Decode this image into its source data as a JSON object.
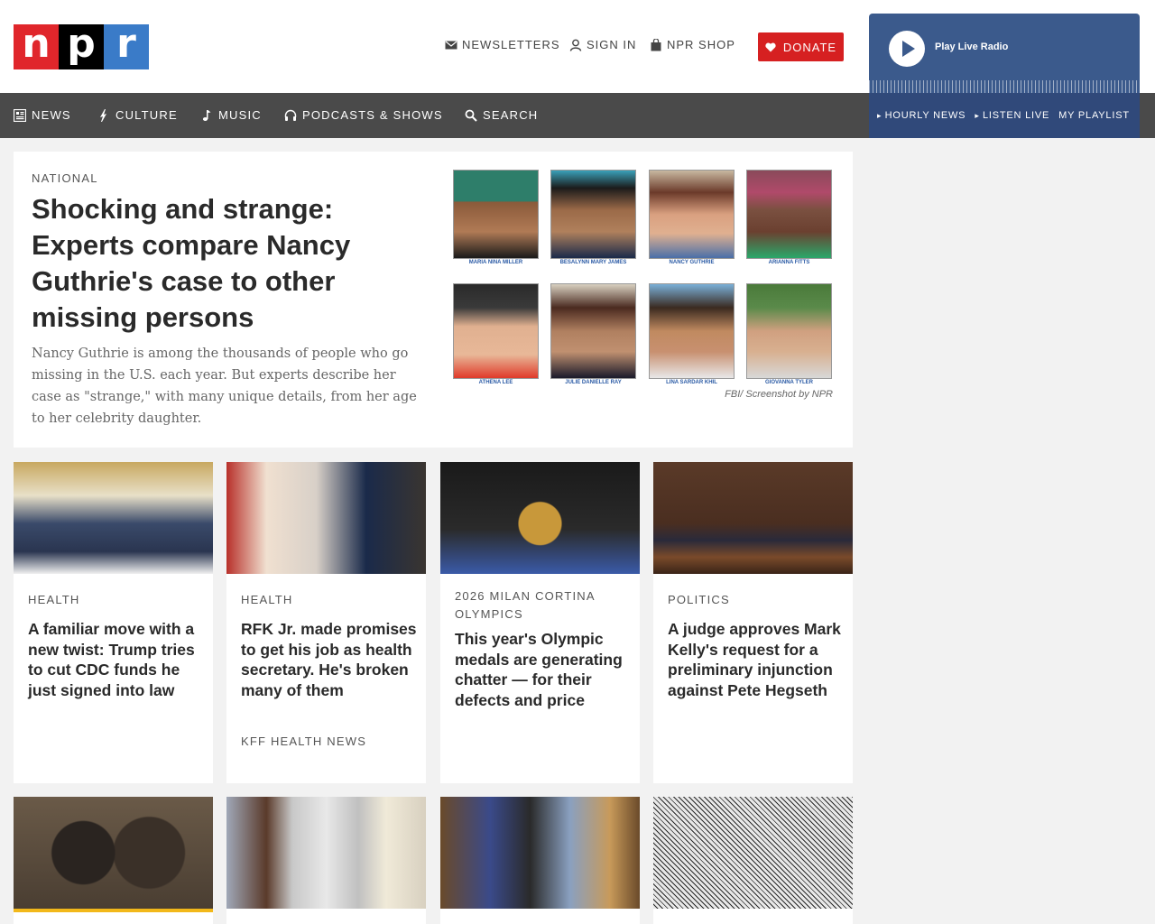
{
  "header": {
    "logo_letters": [
      "n",
      "p",
      "r"
    ],
    "utility": {
      "newsletters": "NEWSLETTERS",
      "sign_in": "SIGN IN",
      "shop": "NPR SHOP",
      "donate": "DONATE"
    }
  },
  "nav": {
    "items": [
      {
        "label": "NEWS",
        "icon": "news-icon"
      },
      {
        "label": "CULTURE",
        "icon": "culture-icon"
      },
      {
        "label": "MUSIC",
        "icon": "music-note-icon"
      },
      {
        "label": "PODCASTS & SHOWS",
        "icon": "headphones-icon"
      },
      {
        "label": "SEARCH",
        "icon": "search-icon"
      }
    ]
  },
  "player": {
    "title": "Play Live Radio",
    "links": [
      "HOURLY NEWS",
      "LISTEN LIVE",
      "MY PLAYLIST"
    ]
  },
  "feature": {
    "slug": "NATIONAL",
    "headline": "Shocking and strange: Experts compare Nancy Guthrie's case to other missing persons",
    "teaser": "Nancy Guthrie is among the thousands of people who go missing in the U.S. each year. But experts describe her case as \"strange,\" with many unique details, from her age to her celebrity daughter.",
    "photo_captions": [
      "MARIA NINA MILLER",
      "BESALYNN MARY JAMES",
      "NANCY GUTHRIE",
      "ARIANNA FITTS",
      "ATHENA LEE",
      "JULIE DANIELLE RAY",
      "LINA SARDAR KHIL",
      "GIOVANNA TYLER"
    ],
    "credit": "FBI/ Screenshot by NPR"
  },
  "cards": [
    {
      "slug": "HEALTH",
      "headline": "A familiar move with a new twist: Trump tries to cut CDC funds he just signed into law",
      "source": ""
    },
    {
      "slug": "HEALTH",
      "headline": "RFK Jr. made promises to get his job as health secretary. He's broken many of them",
      "source": "KFF HEALTH NEWS"
    },
    {
      "slug": "2026 MILAN CORTINA OLYMPICS",
      "headline": "This year's Olympic medals are generating chatter — for their defects and price",
      "source": ""
    },
    {
      "slug": "POLITICS",
      "headline": "A judge approves Mark Kelly's request for a preliminary injunction against Pete Hegseth",
      "source": ""
    }
  ],
  "colors": {
    "npr_red": "#e0262b",
    "npr_blue": "#3a7bc8",
    "donate": "#d62021",
    "nav_bg": "#4a4a4a",
    "player_bg": "#3b5a8c"
  }
}
